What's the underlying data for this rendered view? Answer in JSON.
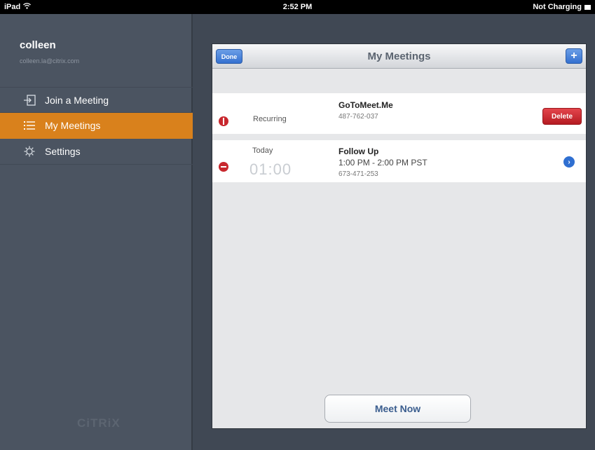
{
  "status_bar": {
    "device": "iPad",
    "time": "2:52 PM",
    "battery": "Not Charging"
  },
  "sidebar": {
    "user_name": "colleen",
    "user_email": "colleen.la@citrix.com",
    "items": [
      {
        "label": "Join a Meeting",
        "icon": "join-icon"
      },
      {
        "label": "My Meetings",
        "icon": "list-icon"
      },
      {
        "label": "Settings",
        "icon": "gear-icon"
      }
    ],
    "logo_text": "CiTRiX"
  },
  "panel": {
    "title": "My Meetings",
    "done_label": "Done",
    "add_label": "+",
    "meetings": [
      {
        "when": "Recurring",
        "title": "GoToMeet.Me",
        "id": "487-762-037",
        "action_label": "Delete"
      },
      {
        "when": "Today",
        "time": "01:00",
        "title": "Follow Up",
        "schedule": "1:00 PM - 2:00 PM PST",
        "id": "673-471-253"
      }
    ],
    "meet_now_label": "Meet Now"
  },
  "colors": {
    "accent": "#d9811c",
    "sidebar": "#4b5461",
    "delete": "#c8282e",
    "button_blue": "#3470d0"
  }
}
